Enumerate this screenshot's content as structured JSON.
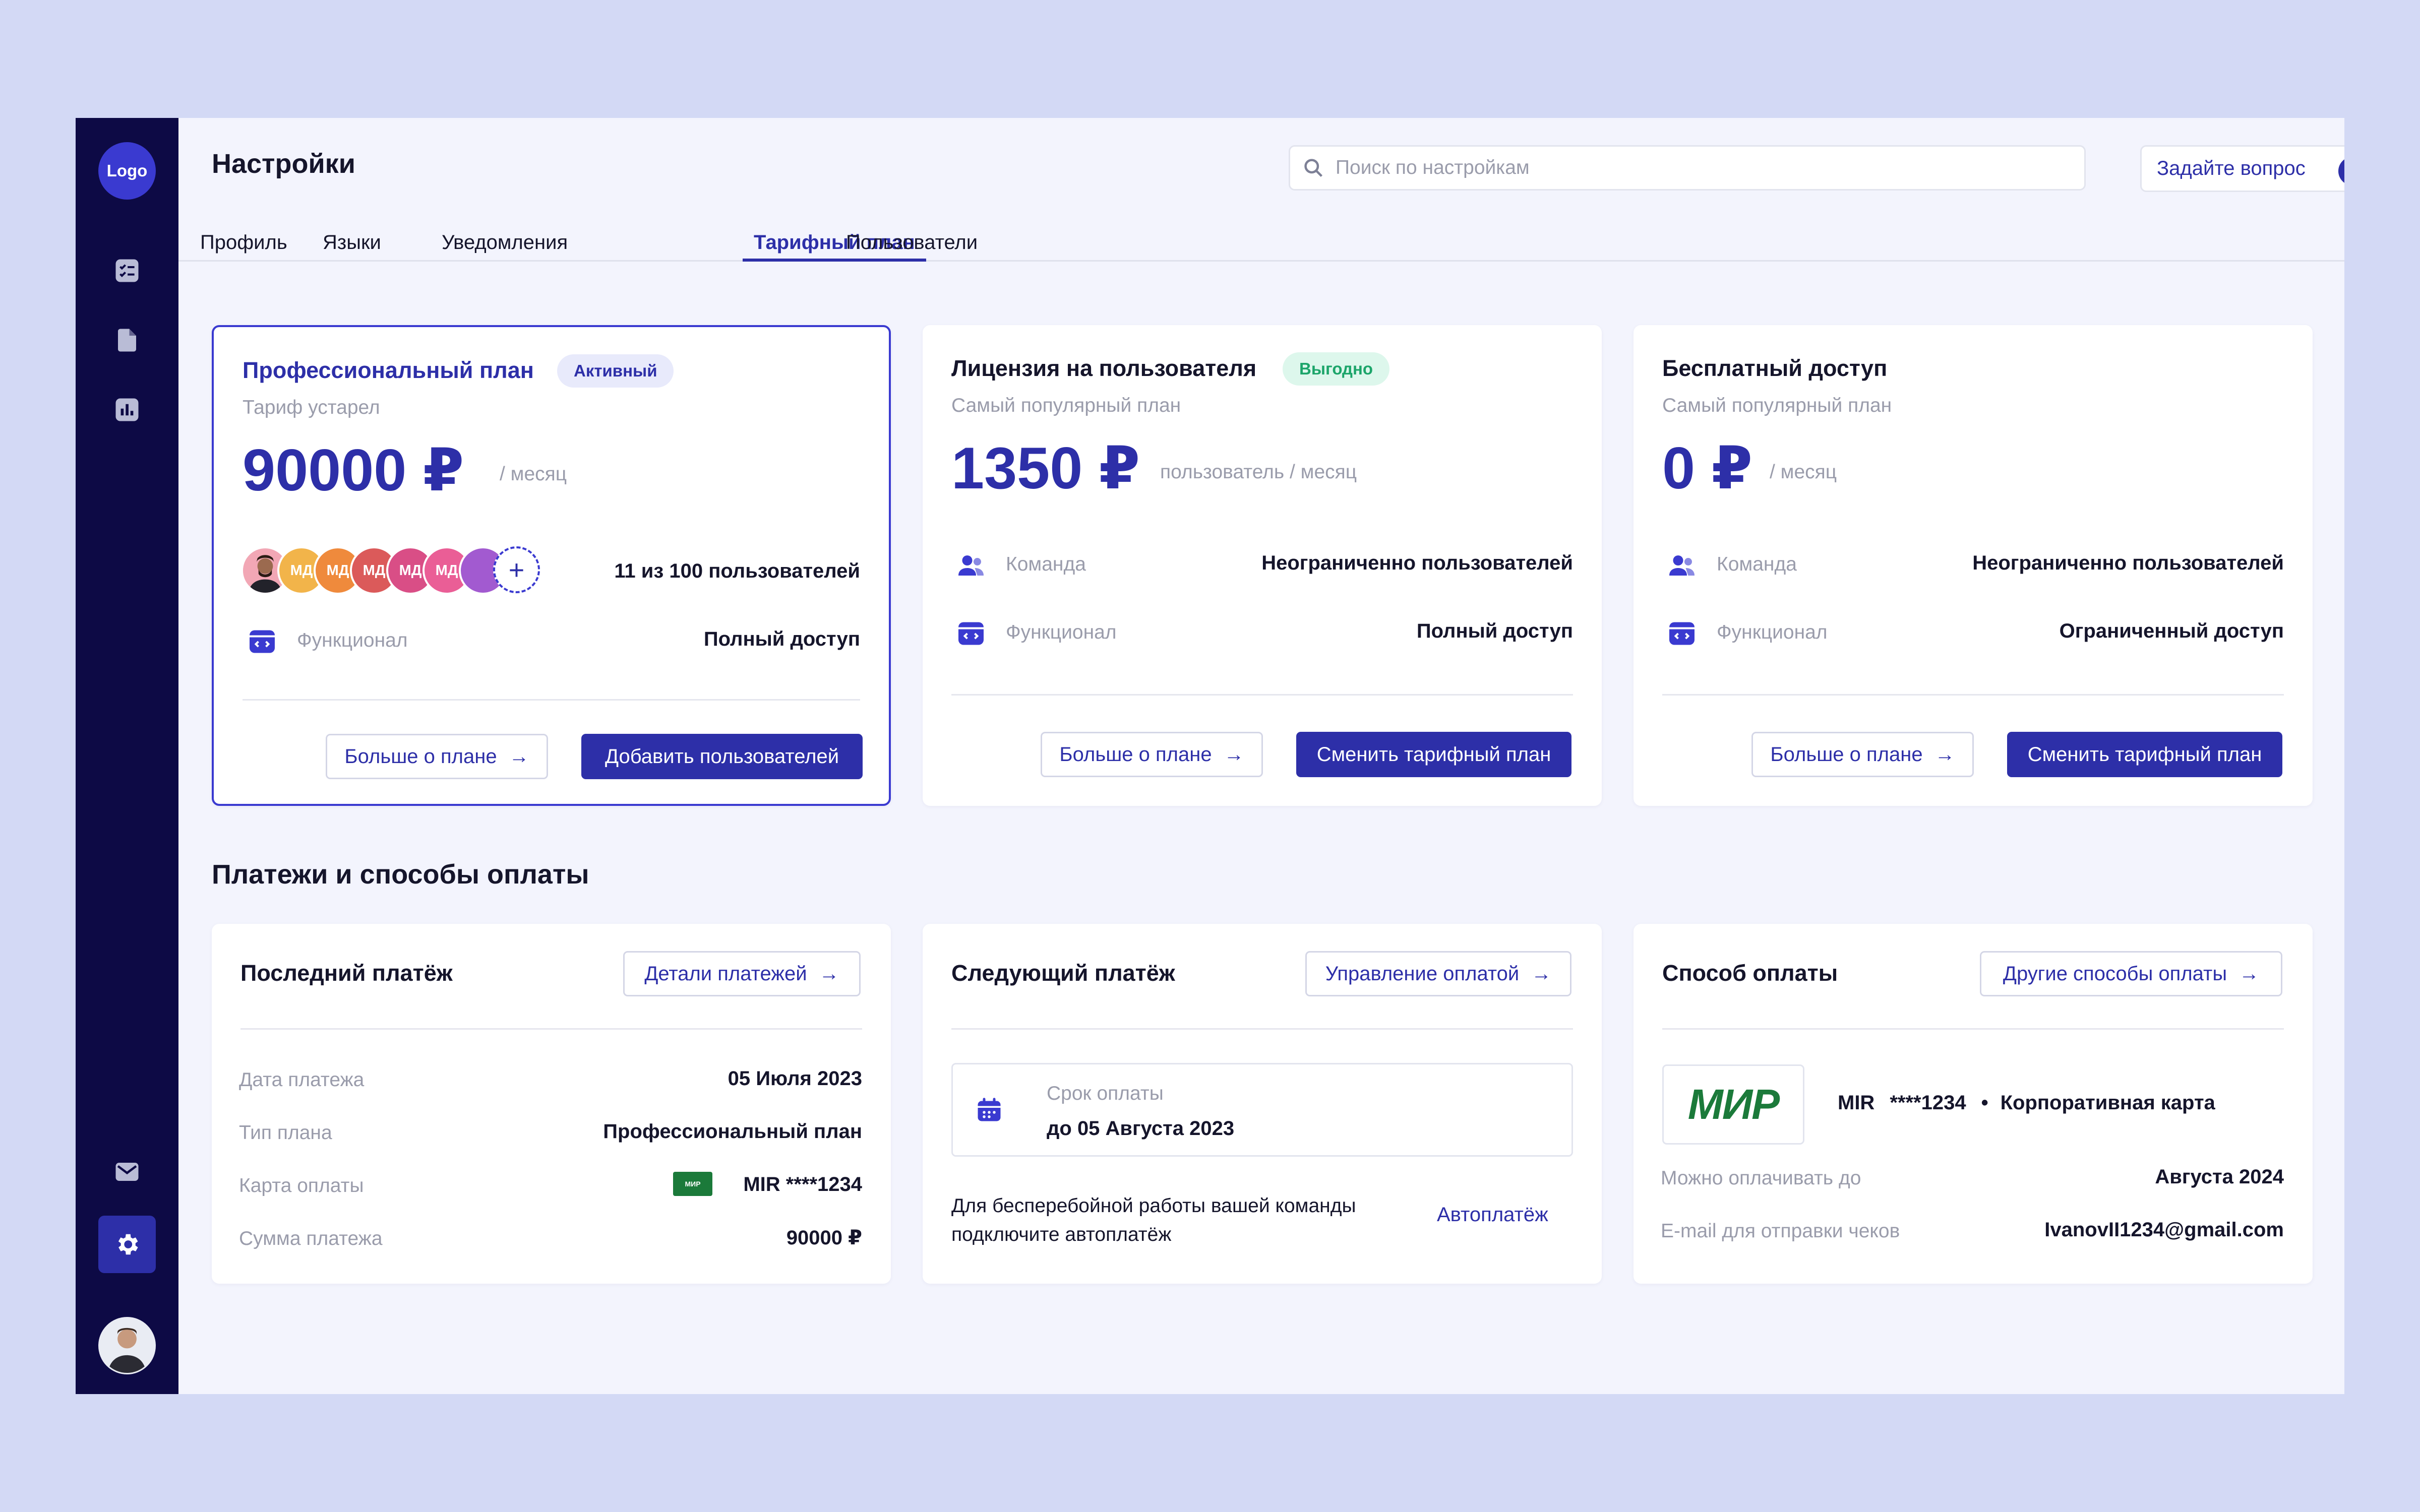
{
  "sidebar": {
    "logo": "Logo"
  },
  "header": {
    "title": "Настройки",
    "search_placeholder": "Поиск по настройкам",
    "ask_label": "Задайте вопрос",
    "ask_icon": "?"
  },
  "tabs": [
    {
      "label": "Профиль",
      "active": false
    },
    {
      "label": "Языки",
      "active": false
    },
    {
      "label": "Уведомления",
      "active": false
    },
    {
      "label": "Тарифный план",
      "active": true
    },
    {
      "label": "Пользователи",
      "active": false
    }
  ],
  "plans": [
    {
      "name": "Профессиональный план",
      "badge": "Активный",
      "subtitle": "Тариф устарел",
      "price": "90000 ₽",
      "period": "/ месяц",
      "avatars": [
        "МД",
        "МД",
        "МД",
        "МД",
        "МД"
      ],
      "users_count": "11 из 100 пользователей",
      "feature_label": "Функционал",
      "feature_value": "Полный доступ",
      "more_label": "Больше о плане",
      "action_label": "Добавить пользователей"
    },
    {
      "name": "Лицензия на пользователя",
      "badge": "Выгодно",
      "subtitle": "Самый популярный план",
      "price": "1350 ₽",
      "period": "пользователь / месяц",
      "team_label": "Команда",
      "team_value": "Неограниченно пользователей",
      "feature_label": "Функционал",
      "feature_value": "Полный доступ",
      "more_label": "Больше о плане",
      "action_label": "Сменить тарифный план"
    },
    {
      "name": "Бесплатный доступ",
      "subtitle": "Самый популярный план",
      "price": "0 ₽",
      "period": "/ месяц",
      "team_label": "Команда",
      "team_value": "Неограниченно пользователей",
      "feature_label": "Функционал",
      "feature_value": "Ограниченный доступ",
      "more_label": "Больше о плане",
      "action_label": "Сменить тарифный план"
    }
  ],
  "payments": {
    "title": "Платежи и способы оплаты",
    "last": {
      "title": "Последний платёж",
      "link": "Детали платежей",
      "date_label": "Дата платежа",
      "date_value": "05 Июля 2023",
      "plan_label": "Тип плана",
      "plan_value": "Профессиональный план",
      "card_label": "Карта оплаты",
      "card_value": "MIR ****1234",
      "card_mini": "МИР",
      "sum_label": "Сумма платежа",
      "sum_value": "90000 ₽"
    },
    "next": {
      "title": "Следующий платёж",
      "link": "Управление оплатой",
      "due_label": "Срок оплаты",
      "due_value": "до 05 Августа 2023",
      "auto_text": "Для бесперебойной работы вашей команды подключите автоплатёж",
      "auto_link": "Автоплатёж"
    },
    "method": {
      "title": "Способ оплаты",
      "link": "Другие способы оплаты",
      "logo": "МИР",
      "card_brand": "MIR",
      "card_number": "****1234",
      "card_sep": "•",
      "card_type": "Корпоративная карта",
      "valid_label": "Можно оплачивать до",
      "valid_value": "Августа 2024",
      "email_label": "E-mail для отправки чеков",
      "email_value": "IvanovII1234@gmail.com"
    }
  },
  "colors": {
    "primary": "#2d2fa8",
    "sidebar": "#0d0a45",
    "background": "#d3d9f5",
    "badge_green": "#1ca56a",
    "mir_green": "#1b7a3a"
  }
}
